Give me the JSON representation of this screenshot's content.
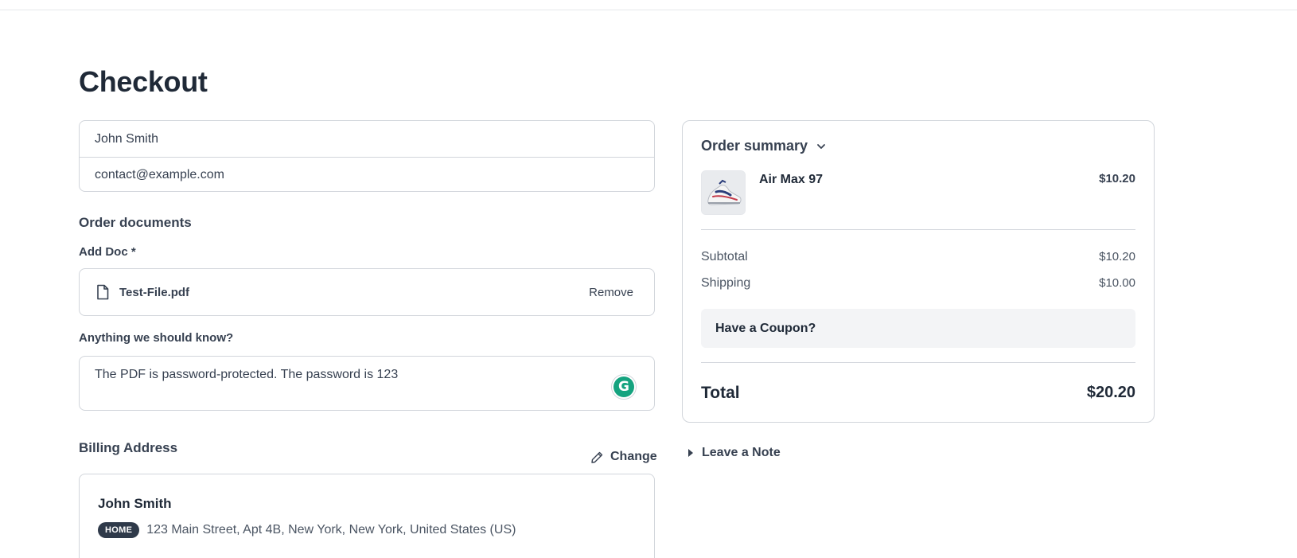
{
  "page": {
    "title": "Checkout"
  },
  "contact": {
    "name": "John Smith",
    "email": "contact@example.com"
  },
  "documents": {
    "heading": "Order documents",
    "add_label": "Add Doc *",
    "file_name": "Test-File.pdf",
    "remove_label": "Remove"
  },
  "notes": {
    "label": "Anything we should know?",
    "value": "The PDF is password-protected. The password is 123",
    "assistant_icon": "grammarly-icon",
    "assistant_color": "#15a37f"
  },
  "billing": {
    "heading": "Billing Address",
    "change_label": "Change",
    "name": "John Smith",
    "badge": "HOME",
    "address": "123 Main Street, Apt 4B, New York, New York, United States (US)"
  },
  "summary": {
    "heading": "Order summary",
    "item": {
      "name": "Air Max 97",
      "price": "$10.20"
    },
    "subtotal_label": "Subtotal",
    "subtotal_value": "$10.20",
    "shipping_label": "Shipping",
    "shipping_value": "$10.00",
    "coupon_label": "Have a Coupon?",
    "total_label": "Total",
    "total_value": "$20.20"
  },
  "leave_note": {
    "label": "Leave a Note"
  }
}
